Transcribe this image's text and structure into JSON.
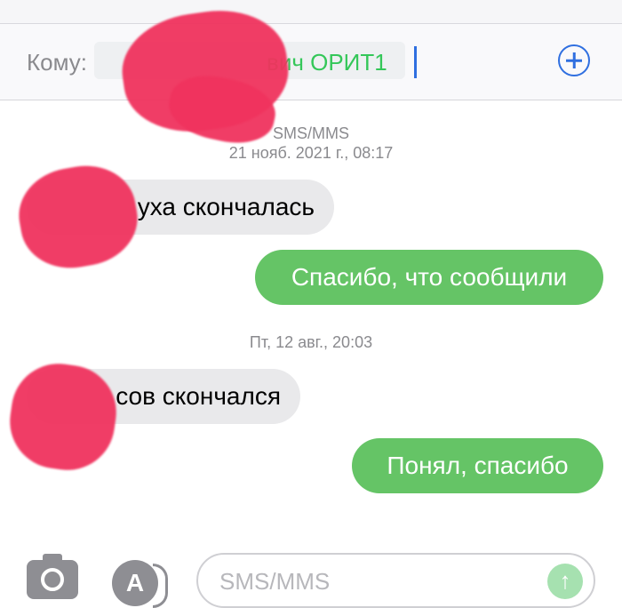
{
  "header": {
    "to_label": "Кому:",
    "recipient_name": "вич ОРИТ1"
  },
  "conversation": {
    "service_label": "SMS/MMS",
    "groups": [
      {
        "timestamp": "21 нояб. 2021 г., 08:17",
        "messages": [
          {
            "direction": "incoming",
            "text": "уха скончалась"
          },
          {
            "direction": "outgoing",
            "text": "Спасибо, что сообщили"
          }
        ]
      },
      {
        "timestamp": "Пт, 12 авг., 20:03",
        "messages": [
          {
            "direction": "incoming",
            "text": "сов скончался"
          },
          {
            "direction": "outgoing",
            "text": "Понял, спасибо"
          }
        ]
      }
    ]
  },
  "composer": {
    "placeholder": "SMS/MMS",
    "camera_icon": "camera-icon",
    "appstore_icon": "appstore-icon",
    "send_icon": "arrow-up-icon"
  },
  "colors": {
    "outgoing_bubble": "#65c466",
    "incoming_bubble": "#e9e9eb",
    "recipient_text": "#34c759",
    "accent_blue": "#2f6fe0",
    "redaction": "#f0335e"
  }
}
